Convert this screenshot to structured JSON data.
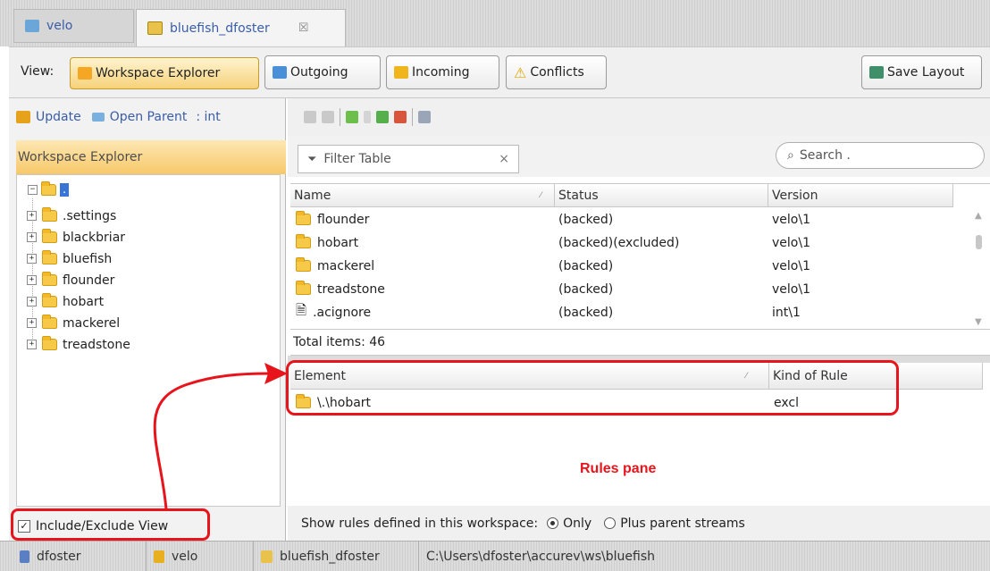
{
  "tabs": [
    {
      "label": "velo"
    },
    {
      "label": "bluefish_dfoster",
      "close": "☒"
    }
  ],
  "view_bar": {
    "label": "View:",
    "buttons": [
      "Workspace Explorer",
      "Outgoing",
      "Incoming",
      "Conflicts"
    ],
    "save_layout": "Save Layout"
  },
  "left_toolbar": {
    "update": "Update",
    "open_parent": "Open Parent",
    "stream": ": int"
  },
  "left_panel": {
    "title": "Workspace Explorer",
    "root": ".",
    "tree": [
      ".settings",
      "blackbriar",
      "bluefish",
      "flounder",
      "hobart",
      "mackerel",
      "treadstone"
    ],
    "checkbox_label": "Include/Exclude View",
    "checkbox_checked": true
  },
  "filter": {
    "placeholder": "Filter Table",
    "clear": "×",
    "search_placeholder": "Search ."
  },
  "file_table": {
    "columns": [
      "Name",
      "Status",
      "Version"
    ],
    "rows": [
      {
        "name": "flounder",
        "status": "(backed)",
        "version": "velo\\1",
        "type": "folder"
      },
      {
        "name": "hobart",
        "status": "(backed)(excluded)",
        "version": "velo\\1",
        "type": "folder"
      },
      {
        "name": "mackerel",
        "status": "(backed)",
        "version": "velo\\1",
        "type": "folder"
      },
      {
        "name": "treadstone",
        "status": "(backed)",
        "version": "velo\\1",
        "type": "folder"
      },
      {
        "name": ".acignore",
        "status": "(backed)",
        "version": "int\\1",
        "type": "file"
      }
    ],
    "total": "Total items: 46"
  },
  "rules_table": {
    "columns": [
      "Element",
      "Kind of Rule"
    ],
    "rows": [
      {
        "element": "\\.\\hobart",
        "kind": "excl"
      }
    ],
    "annotation": "Rules pane"
  },
  "rules_options": {
    "label": "Show rules defined in this workspace:",
    "only": "Only",
    "plus_parent": "Plus parent streams",
    "selected": "Only"
  },
  "status_bar": {
    "user": "dfoster",
    "depot": "velo",
    "workspace": "bluefish_dfoster",
    "path": "C:\\Users\\dfoster\\accurev\\ws\\bluefish"
  },
  "colors": {
    "annotation_red": "#e8141b",
    "folder_yellow": "#f7c948",
    "panel_header": "#fbd98a",
    "link_blue": "#3a5da8"
  }
}
